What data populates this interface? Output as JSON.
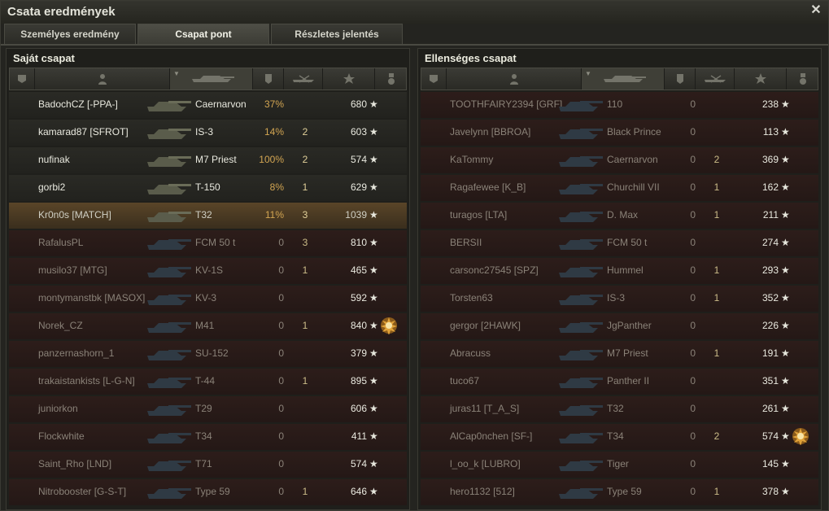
{
  "window": {
    "title": "Csata eredmények"
  },
  "tabs": [
    {
      "label": "Személyes eredmény"
    },
    {
      "label": "Csapat pont"
    },
    {
      "label": "Részletes jelentés"
    }
  ],
  "icons": {
    "close": "close-icon",
    "rank": "rank-icon",
    "player": "player-icon",
    "tank": "tank-icon",
    "damage": "shield-icon",
    "kills": "destroyed-tank-icon",
    "xp": "star-icon",
    "medal": "medal-icon",
    "row_star": "★"
  },
  "colors": {
    "accent": "#d2a552",
    "dead_row": "#2d1d1a",
    "player_row": "#5a4528"
  },
  "left": {
    "title": "Saját csapat",
    "rows": [
      {
        "name": "BadochCZ [-PPA-]",
        "tank": "Caernarvon",
        "dmg": "37%",
        "kills": "",
        "xp": "680",
        "state": "alive"
      },
      {
        "name": "kamarad87 [SFROT]",
        "tank": "IS-3",
        "dmg": "14%",
        "kills": "2",
        "xp": "603",
        "state": "alive"
      },
      {
        "name": "nufinak",
        "tank": "M7 Priest",
        "dmg": "100%",
        "kills": "2",
        "xp": "574",
        "state": "alive"
      },
      {
        "name": "gorbi2",
        "tank": "T-150",
        "dmg": "8%",
        "kills": "1",
        "xp": "629",
        "state": "alive"
      },
      {
        "name": "Kr0n0s [MATCH]",
        "tank": "T32",
        "dmg": "11%",
        "kills": "3",
        "xp": "1039",
        "state": "player"
      },
      {
        "name": "RafalusPL",
        "tank": "FCM 50 t",
        "dmg": "0",
        "kills": "3",
        "xp": "810",
        "state": "dead"
      },
      {
        "name": "musilo37 [MTG]",
        "tank": "KV-1S",
        "dmg": "0",
        "kills": "1",
        "xp": "465",
        "state": "dead"
      },
      {
        "name": "montymanstbk [MASOX]",
        "tank": "KV-3",
        "dmg": "0",
        "kills": "",
        "xp": "592",
        "state": "dead"
      },
      {
        "name": "Norek_CZ",
        "tank": "M41",
        "dmg": "0",
        "kills": "1",
        "xp": "840",
        "state": "dead",
        "medal": true
      },
      {
        "name": "panzernashorn_1",
        "tank": "SU-152",
        "dmg": "0",
        "kills": "",
        "xp": "379",
        "state": "dead"
      },
      {
        "name": "trakaistankists [L-G-N]",
        "tank": "T-44",
        "dmg": "0",
        "kills": "1",
        "xp": "895",
        "state": "dead"
      },
      {
        "name": "juniorkon",
        "tank": "T29",
        "dmg": "0",
        "kills": "",
        "xp": "606",
        "state": "dead"
      },
      {
        "name": "Flockwhite",
        "tank": "T34",
        "dmg": "0",
        "kills": "",
        "xp": "411",
        "state": "dead"
      },
      {
        "name": "Saint_Rho [LND]",
        "tank": "T71",
        "dmg": "0",
        "kills": "",
        "xp": "574",
        "state": "dead"
      },
      {
        "name": "Nitrobooster [G-S-T]",
        "tank": "Type 59",
        "dmg": "0",
        "kills": "1",
        "xp": "646",
        "state": "dead"
      }
    ]
  },
  "right": {
    "title": "Ellenséges csapat",
    "rows": [
      {
        "name": "TOOTHFAIRY2394 [GRF]",
        "tank": "110",
        "dmg": "0",
        "kills": "",
        "xp": "238",
        "state": "dead"
      },
      {
        "name": "Javelynn [BBROA]",
        "tank": "Black Prince",
        "dmg": "0",
        "kills": "",
        "xp": "113",
        "state": "dead"
      },
      {
        "name": "KaTommy",
        "tank": "Caernarvon",
        "dmg": "0",
        "kills": "2",
        "xp": "369",
        "state": "dead"
      },
      {
        "name": "Ragafewee [K_B]",
        "tank": "Churchill VII",
        "dmg": "0",
        "kills": "1",
        "xp": "162",
        "state": "dead"
      },
      {
        "name": "turagos [LTA]",
        "tank": "D. Max",
        "dmg": "0",
        "kills": "1",
        "xp": "211",
        "state": "dead"
      },
      {
        "name": "BERSII",
        "tank": "FCM 50 t",
        "dmg": "0",
        "kills": "",
        "xp": "274",
        "state": "dead"
      },
      {
        "name": "carsonc27545 [SPZ]",
        "tank": "Hummel",
        "dmg": "0",
        "kills": "1",
        "xp": "293",
        "state": "dead"
      },
      {
        "name": "Torsten63",
        "tank": "IS-3",
        "dmg": "0",
        "kills": "1",
        "xp": "352",
        "state": "dead"
      },
      {
        "name": "gergor [2HAWK]",
        "tank": "JgPanther",
        "dmg": "0",
        "kills": "",
        "xp": "226",
        "state": "dead"
      },
      {
        "name": "Abracuss",
        "tank": "M7 Priest",
        "dmg": "0",
        "kills": "1",
        "xp": "191",
        "state": "dead"
      },
      {
        "name": "tuco67",
        "tank": "Panther II",
        "dmg": "0",
        "kills": "",
        "xp": "351",
        "state": "dead"
      },
      {
        "name": "juras11 [T_A_S]",
        "tank": "T32",
        "dmg": "0",
        "kills": "",
        "xp": "261",
        "state": "dead"
      },
      {
        "name": "AlCap0nchen [SF-]",
        "tank": "T34",
        "dmg": "0",
        "kills": "2",
        "xp": "574",
        "state": "dead",
        "medal": true
      },
      {
        "name": "l_oo_k [LUBRO]",
        "tank": "Tiger",
        "dmg": "0",
        "kills": "",
        "xp": "145",
        "state": "dead"
      },
      {
        "name": "hero1132 [512]",
        "tank": "Type 59",
        "dmg": "0",
        "kills": "1",
        "xp": "378",
        "state": "dead"
      }
    ]
  }
}
